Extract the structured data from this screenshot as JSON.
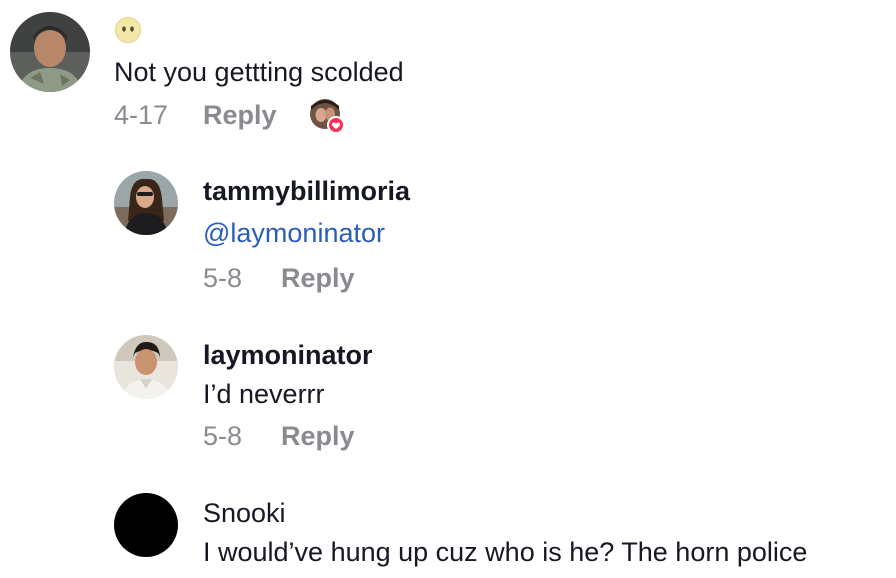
{
  "top_comment": {
    "emoji": "😶",
    "text": "Not you gettting scolded",
    "date": "4-17",
    "reply_label": "Reply"
  },
  "replies": [
    {
      "username": "tammybillimoria",
      "mention": "@laymoninator",
      "date": "5-8",
      "reply_label": "Reply"
    },
    {
      "username": "laymoninator",
      "text": "I’d neverrr",
      "date": "5-8",
      "reply_label": "Reply"
    },
    {
      "username": "Snooki",
      "text": "I would’ve hung up cuz who is he? The horn police"
    }
  ],
  "colors": {
    "mention": "#2B5DB9",
    "muted": "#8a8b91",
    "like_badge": "#FE2C55"
  },
  "icons": {
    "creator_like": "heart-icon"
  }
}
